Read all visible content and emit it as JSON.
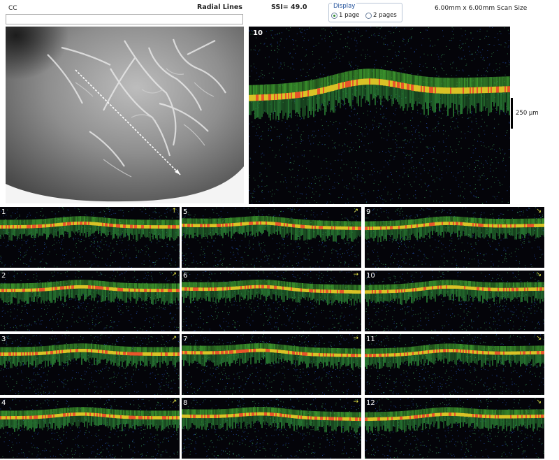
{
  "header": {
    "eye": "CC",
    "scan_type": "Radial Lines",
    "ssi": "SSI= 49.0",
    "scan_size": "6.00mm x 6.00mm Scan Size"
  },
  "display": {
    "title": "Display",
    "options": [
      "1 page",
      "2 pages"
    ],
    "selected": "1 page"
  },
  "large_scan": {
    "number": "10"
  },
  "scale": {
    "label": "250 µm"
  },
  "thumbnails": [
    {
      "number": "1",
      "arrow": "↑"
    },
    {
      "number": "5",
      "arrow": "↗"
    },
    {
      "number": "9",
      "arrow": "↘"
    },
    {
      "number": "2",
      "arrow": "↗"
    },
    {
      "number": "6",
      "arrow": "→"
    },
    {
      "number": "10",
      "arrow": "↘"
    },
    {
      "number": "3",
      "arrow": "↗"
    },
    {
      "number": "7",
      "arrow": "→"
    },
    {
      "number": "11",
      "arrow": "↘"
    },
    {
      "number": "4",
      "arrow": "↗"
    },
    {
      "number": "8",
      "arrow": "→"
    },
    {
      "number": "12",
      "arrow": "↘"
    }
  ]
}
